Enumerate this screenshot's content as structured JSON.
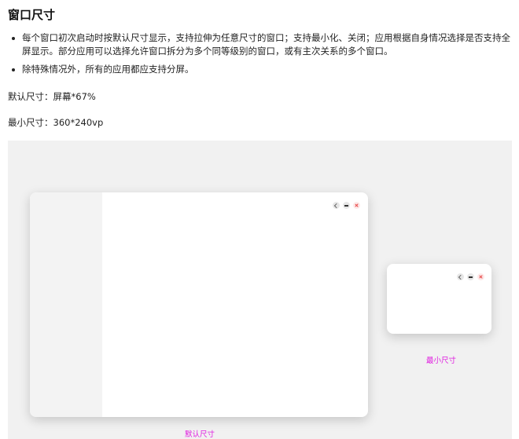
{
  "section": {
    "title": "窗口尺寸",
    "bullets": [
      "每个窗口初次启动时按默认尺寸显示，支持拉伸为任意尺寸的窗口；支持最小化、关闭；应用根据自身情况选择是否支持全屏显示。部分应用可以选择允许窗口拆分为多个同等级别的窗口，或有主次关系的多个窗口。",
      "除特殊情况外，所有的应用都应支持分屏。"
    ],
    "default_size": "默认尺寸：屏幕*67%",
    "min_size": "最小尺寸：360*240vp"
  },
  "illustration": {
    "default_caption": "默认尺寸",
    "min_caption": "最小尺寸",
    "close_color": "#e84a4a",
    "caption_color": "#e020e0"
  }
}
